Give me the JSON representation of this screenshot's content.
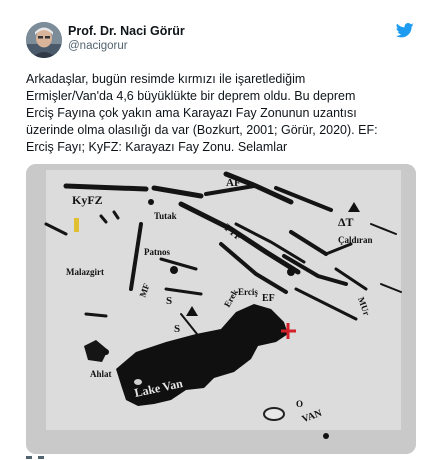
{
  "author": {
    "name": "Prof. Dr. Naci Görür",
    "handle": "@nacigorur"
  },
  "icons": {
    "avatar": "profile-photo",
    "brand": "twitter-bird-icon"
  },
  "colors": {
    "brand": "#1d9bf0",
    "text": "#0f1419",
    "secondary": "#536471",
    "marker": "#d4202a"
  },
  "tweet": {
    "lines": [
      "Arkadaşlar, bugün resimde kırmızı ile işaretlediğim",
      "Ermişler/Van'da 4,6 büyüklükte bir deprem oldu. Bu deprem",
      "Erciş Fayına çok yakın ama Karayazı Fay Zonunun uzantısı",
      "üzerinde olma olasılığı da var (Bozkurt, 2001; Görür, 2020). EF:",
      "Erciş Fayı; KyFZ: Karayazı Fay Zonu. Selamlar"
    ]
  },
  "map": {
    "labels": {
      "kyfz": "KyFZ",
      "af": "AF",
      "tutak": "Tutak",
      "tyf": "TYF",
      "patnos": "Patnos",
      "malazgirt": "Malazgirt",
      "mf": "MF",
      "s1": "S",
      "s2": "S",
      "erek": "Erek",
      "ercis": "Erciş",
      "ef": "EF",
      "mur": "MUr",
      "delta_t": "ΔT",
      "caldiran": "Çaldıran",
      "ahlat": "Ahlat",
      "lake_van": "Lake Van",
      "van": "VAN",
      "o": "O"
    }
  }
}
